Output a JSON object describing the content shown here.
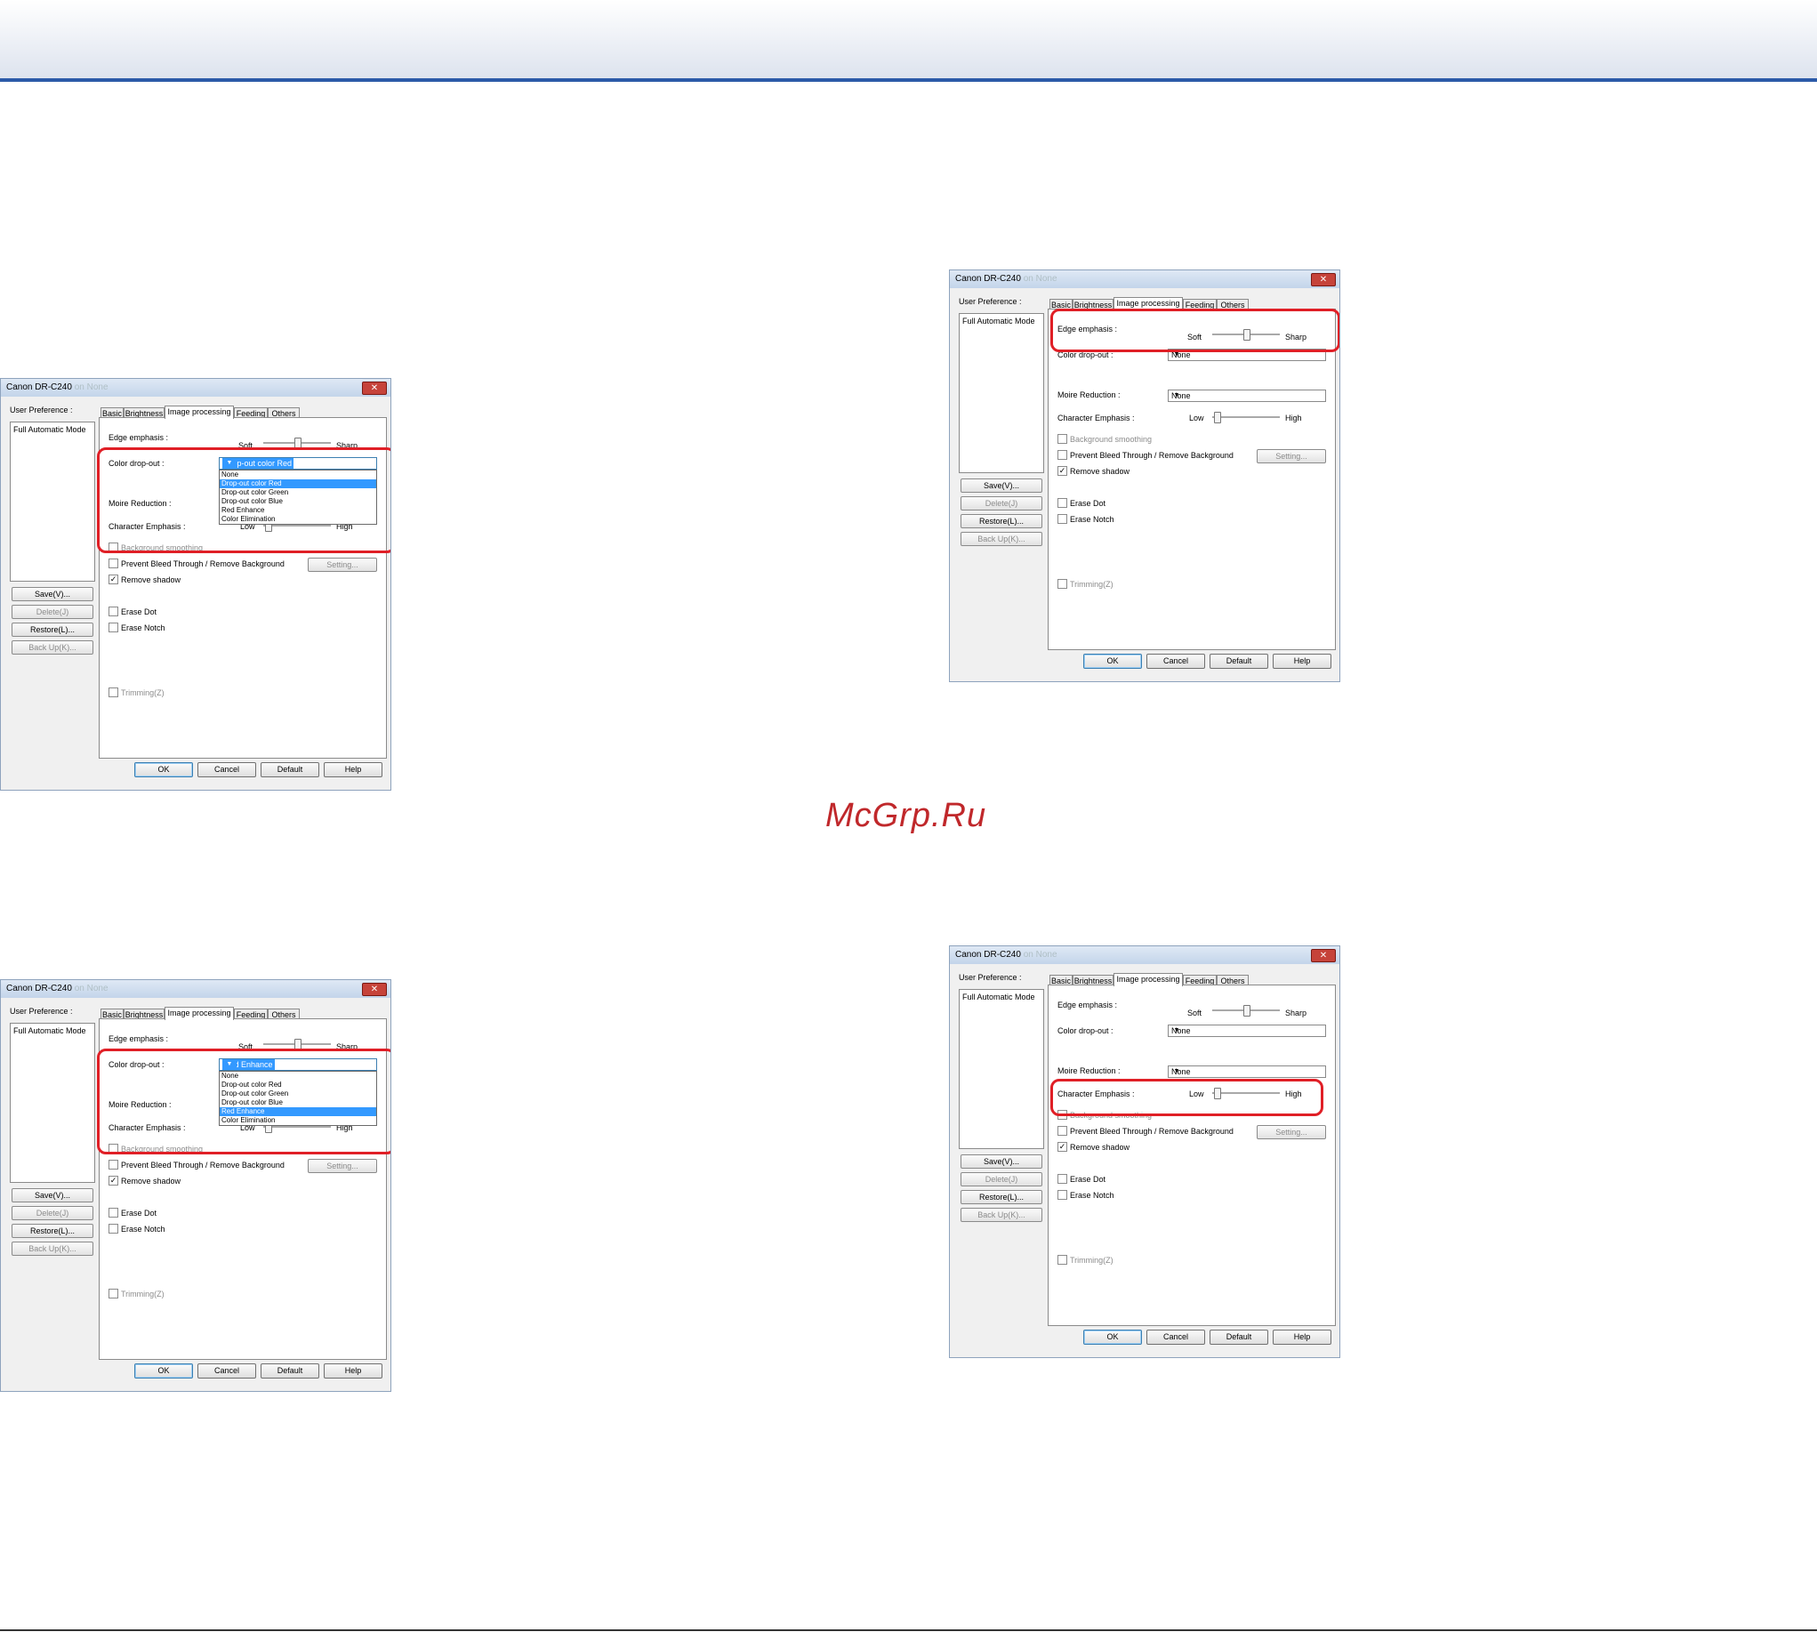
{
  "watermark": "McGrp.Ru",
  "dialog": {
    "title": "Canon DR-C240",
    "title_tail": "on None",
    "close": "✕",
    "user_preference": "User Preference :",
    "pref_item": "Full Automatic Mode",
    "side_buttons": [
      "Save(V)...",
      "Delete(J)",
      "Restore(L)...",
      "Back Up(K)..."
    ],
    "tabs": [
      "Basic",
      "Brightness",
      "Image processing",
      "Feeding",
      "Others"
    ],
    "edge_emphasis": "Edge emphasis :",
    "soft": "Soft",
    "sharp": "Sharp",
    "color_dropout": "Color drop-out :",
    "moire": "Moire Reduction :",
    "character_emphasis": "Character Emphasis :",
    "low": "Low",
    "high": "High",
    "none": "None",
    "dropdown_options": [
      "None",
      "Drop-out color Red",
      "Drop-out color Green",
      "Drop-out color Blue",
      "Red Enhance",
      "Color Elimination"
    ],
    "bg_smoothing": "Background smoothing",
    "prevent_bleed": "Prevent Bleed Through / Remove Background",
    "setting": "Setting...",
    "remove_shadow": "Remove shadow",
    "erase_dot": "Erase Dot",
    "erase_notch": "Erase Notch",
    "trimming": "Trimming(Z)",
    "check_mark": "✓",
    "arrow": "▼",
    "buttons": [
      "OK",
      "Cancel",
      "Default",
      "Help"
    ]
  },
  "screens": [
    {
      "id": "color-dropout-red",
      "combo_value": "Drop-out color Red",
      "selected_option": 1
    },
    {
      "id": "edge-emphasis",
      "highlight": "Edge emphasis"
    },
    {
      "id": "color-dropout-red-enhance",
      "combo_value": "Red Enhance",
      "selected_option": 4
    },
    {
      "id": "character-emphasis",
      "highlight": "Character Emphasis"
    }
  ],
  "colors": {
    "highlight": "#e01f26",
    "accent": "#2b5aa8",
    "selection": "#3399ff"
  }
}
